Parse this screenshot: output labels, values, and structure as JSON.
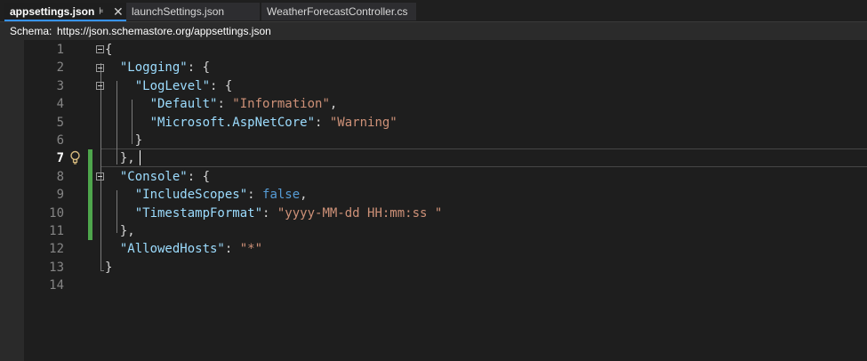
{
  "tabs": [
    {
      "label": "appsettings.json",
      "active": true
    },
    {
      "label": "launchSettings.json",
      "active": false
    },
    {
      "label": "WeatherForecastController.cs",
      "active": false
    }
  ],
  "tab_pin_glyph": "⊧",
  "tab_close_glyph": "✕",
  "schema": {
    "label": "Schema:",
    "url": "https://json.schemastore.org/appsettings.json"
  },
  "editor": {
    "current_line": 7,
    "line_numbers": [
      "1",
      "2",
      "3",
      "4",
      "5",
      "6",
      "7",
      "8",
      "9",
      "10",
      "11",
      "12",
      "13",
      "14"
    ],
    "lines": [
      [
        {
          "t": "punc",
          "v": "{"
        }
      ],
      [
        {
          "t": "key",
          "v": "  \"Logging\""
        },
        {
          "t": "punc",
          "v": ": {"
        }
      ],
      [
        {
          "t": "key",
          "v": "    \"LogLevel\""
        },
        {
          "t": "punc",
          "v": ": {"
        }
      ],
      [
        {
          "t": "key",
          "v": "      \"Default\""
        },
        {
          "t": "punc",
          "v": ": "
        },
        {
          "t": "str",
          "v": "\"Information\""
        },
        {
          "t": "punc",
          "v": ","
        }
      ],
      [
        {
          "t": "key",
          "v": "      \"Microsoft.AspNetCore\""
        },
        {
          "t": "punc",
          "v": ": "
        },
        {
          "t": "str",
          "v": "\"Warning\""
        }
      ],
      [
        {
          "t": "punc",
          "v": "    }"
        }
      ],
      [
        {
          "t": "punc",
          "v": "  },"
        }
      ],
      [
        {
          "t": "key",
          "v": "  \"Console\""
        },
        {
          "t": "punc",
          "v": ": {"
        }
      ],
      [
        {
          "t": "key",
          "v": "    \"IncludeScopes\""
        },
        {
          "t": "punc",
          "v": ": "
        },
        {
          "t": "kw",
          "v": "false"
        },
        {
          "t": "punc",
          "v": ","
        }
      ],
      [
        {
          "t": "key",
          "v": "    \"TimestampFormat\""
        },
        {
          "t": "punc",
          "v": ": "
        },
        {
          "t": "str",
          "v": "\"yyyy-MM-dd HH:mm:ss \""
        }
      ],
      [
        {
          "t": "punc",
          "v": "  },"
        }
      ],
      [
        {
          "t": "key",
          "v": "  \"AllowedHosts\""
        },
        {
          "t": "punc",
          "v": ": "
        },
        {
          "t": "str",
          "v": "\"*\""
        }
      ],
      [
        {
          "t": "punc",
          "v": "}"
        }
      ],
      []
    ]
  },
  "colors": {
    "accent": "#3794ff",
    "key": "#9cdcfe",
    "string": "#ce9178",
    "keyword": "#569cd6",
    "change_bar": "#4ea64c",
    "line_number": "#858585"
  }
}
